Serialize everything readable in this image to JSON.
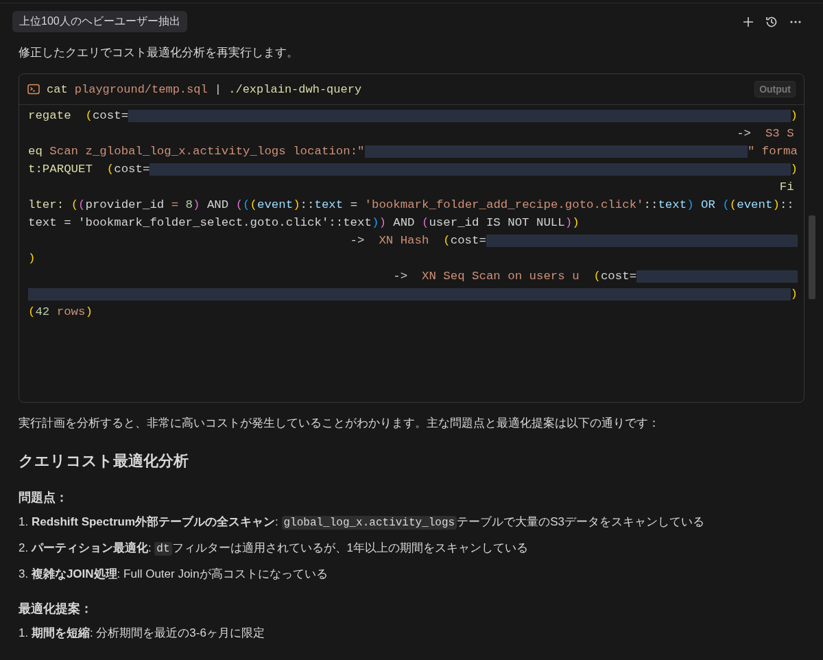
{
  "header": {
    "tag": "上位100人のヘビーユーザー抽出"
  },
  "intro": "修正したクエリでコスト最適化分析を再実行します。",
  "terminal": {
    "command": [
      {
        "kind": "fn",
        "text": "cat "
      },
      {
        "kind": "str",
        "text": "playground/temp.sql"
      },
      {
        "kind": "plain",
        "text": " | "
      },
      {
        "kind": "fn",
        "text": "./explain-dwh-query"
      }
    ],
    "badge": "Output",
    "lines": [
      [
        {
          "kind": "fn",
          "text": "regate  "
        },
        {
          "kind": "p1",
          "text": "("
        },
        {
          "kind": "plain",
          "text": "cost="
        },
        {
          "kind": "redacted"
        },
        {
          "kind": "p1",
          "text": ")"
        }
      ],
      [
        {
          "kind": "plain",
          "text": "                                                                                                   ->  "
        },
        {
          "kind": "str",
          "text": "S3 S"
        }
      ],
      [
        {
          "kind": "fn",
          "text": "eq "
        },
        {
          "kind": "str",
          "text": "Scan z_global_log_x.activity_logs location:\""
        },
        {
          "kind": "redacted"
        },
        {
          "kind": "str",
          "text": "\" forma"
        }
      ],
      [
        {
          "kind": "fn",
          "text": "t:PARQUET  "
        },
        {
          "kind": "p1",
          "text": "("
        },
        {
          "kind": "plain",
          "text": "cost="
        },
        {
          "kind": "redacted"
        },
        {
          "kind": "p1",
          "text": ")"
        }
      ],
      [
        {
          "kind": "fn",
          "text": "                                                                                                         Fi"
        }
      ],
      [
        {
          "kind": "fn",
          "text": "lter: "
        },
        {
          "kind": "p1",
          "text": "("
        },
        {
          "kind": "p2",
          "text": "("
        },
        {
          "kind": "plain",
          "text": "provider_id "
        },
        {
          "kind": "str",
          "text": "= "
        },
        {
          "kind": "num",
          "text": "8"
        },
        {
          "kind": "p2",
          "text": ")"
        },
        {
          "kind": "plain",
          "text": " AND "
        },
        {
          "kind": "p2",
          "text": "("
        },
        {
          "kind": "p3",
          "text": "("
        },
        {
          "kind": "p1",
          "text": "("
        },
        {
          "kind": "var",
          "text": "event"
        },
        {
          "kind": "p1",
          "text": ")"
        },
        {
          "kind": "plain",
          "text": "::"
        },
        {
          "kind": "var",
          "text": "text"
        },
        {
          "kind": "plain",
          "text": " = "
        },
        {
          "kind": "str",
          "text": "'bookmark_folder_add_recipe.goto.click'"
        },
        {
          "kind": "plain",
          "text": "::"
        },
        {
          "kind": "var",
          "text": "text"
        },
        {
          "kind": "p3",
          "text": ")"
        },
        {
          "kind": "var",
          "text": " OR "
        },
        {
          "kind": "p3",
          "text": "("
        },
        {
          "kind": "p1",
          "text": "("
        },
        {
          "kind": "var",
          "text": "event"
        },
        {
          "kind": "p1",
          "text": ")"
        },
        {
          "kind": "plain",
          "text": "::"
        }
      ],
      [
        {
          "kind": "plain",
          "text": "text = 'bookmark_folder_select.goto.click'::text"
        },
        {
          "kind": "p3",
          "text": ")"
        },
        {
          "kind": "p2",
          "text": ")"
        },
        {
          "kind": "plain",
          "text": " AND "
        },
        {
          "kind": "p2",
          "text": "("
        },
        {
          "kind": "plain",
          "text": "user_id IS NOT NULL"
        },
        {
          "kind": "p2",
          "text": ")"
        },
        {
          "kind": "p1",
          "text": ")"
        }
      ],
      [
        {
          "kind": "plain",
          "text": "                                             ->  "
        },
        {
          "kind": "str",
          "text": "XN Hash  "
        },
        {
          "kind": "p1",
          "text": "("
        },
        {
          "kind": "plain",
          "text": "cost="
        },
        {
          "kind": "redacted"
        }
      ],
      [
        {
          "kind": "p1",
          "text": ")"
        }
      ],
      [
        {
          "kind": "plain",
          "text": "                                                   ->  "
        },
        {
          "kind": "str",
          "text": "XN Seq Scan on users u  "
        },
        {
          "kind": "p1",
          "text": "("
        },
        {
          "kind": "plain",
          "text": "cost="
        },
        {
          "kind": "redacted"
        }
      ],
      [
        {
          "kind": "redacted"
        },
        {
          "kind": "p1",
          "text": ")"
        }
      ],
      [
        {
          "kind": "p1",
          "text": "("
        },
        {
          "kind": "num",
          "text": "42"
        },
        {
          "kind": "str",
          "text": " rows"
        },
        {
          "kind": "p1",
          "text": ")"
        }
      ]
    ]
  },
  "summary": "実行計画を分析すると、非常に高いコストが発生していることがわかります。主な問題点と最適化提案は以下の通りです：",
  "heading": "クエリコスト最適化分析",
  "sections": [
    {
      "title": "問題点：",
      "items": [
        [
          {
            "kind": "text",
            "text": "1. **Redshift Spectrum外部テーブルの全スキャン**: "
          },
          {
            "kind": "code",
            "text": "global_log_x.activity_logs"
          },
          {
            "kind": "text",
            "text": "テーブルで大量のS3データをスキャンしている"
          }
        ],
        [
          {
            "kind": "text",
            "text": "2. **パーティション最適化**: "
          },
          {
            "kind": "code",
            "text": "dt"
          },
          {
            "kind": "text",
            "text": "フィルターは適用されているが、1年以上の期間をスキャンしている"
          }
        ],
        [
          {
            "kind": "text",
            "text": "3. **複雑なJOIN処理**: Full Outer Joinが高コストになっている"
          }
        ]
      ]
    },
    {
      "title": "最適化提案：",
      "items": [
        [
          {
            "kind": "text",
            "text": "1. **期間を短縮**: 分析期間を最近の3-6ヶ月に限定"
          }
        ]
      ]
    }
  ]
}
